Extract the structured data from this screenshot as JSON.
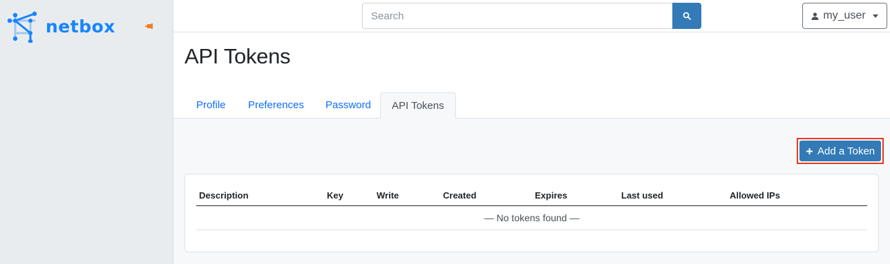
{
  "brand": {
    "name": "netbox"
  },
  "search": {
    "placeholder": "Search"
  },
  "user": {
    "name": "my_user"
  },
  "page": {
    "title": "API Tokens"
  },
  "tabs": [
    {
      "label": "Profile"
    },
    {
      "label": "Preferences"
    },
    {
      "label": "Password"
    },
    {
      "label": "API Tokens",
      "active": true
    }
  ],
  "actions": {
    "add_token_label": "Add a Token"
  },
  "table": {
    "columns": [
      "Description",
      "Key",
      "Write",
      "Created",
      "Expires",
      "Last used",
      "Allowed IPs"
    ],
    "empty_message": "— No tokens found —"
  },
  "colors": {
    "brand": "#1685fc",
    "primary": "#337ab7",
    "highlight": "#e53a1d"
  },
  "icons": {
    "logo": "netbox-logo-icon",
    "pin": "pin-icon",
    "search": "search-icon",
    "user": "user-icon",
    "plus": "plus-icon"
  }
}
